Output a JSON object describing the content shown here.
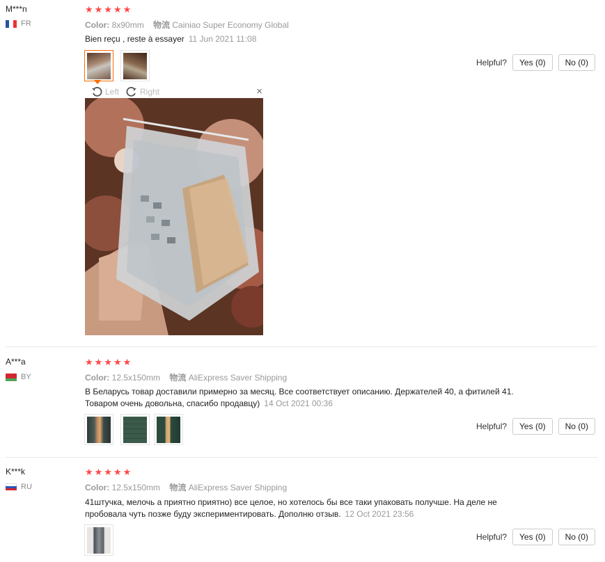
{
  "colors": {
    "star": "#ff4747",
    "active_border": "#ff6a00",
    "muted": "#999999"
  },
  "reviews": [
    {
      "user": "M***n",
      "country": "FR",
      "rating": 5,
      "color_label": "Color:",
      "color_value": "8x90mm",
      "logistics_label": "物流",
      "logistics_value": "Cainiao Super Economy Global",
      "text": "Bien reçu , reste à essayer",
      "date": "11 Jun 2021 11:08",
      "helpful": "Helpful?",
      "yes": "Yes (0)",
      "no": "No (0)"
    },
    {
      "user": "A***a",
      "country": "BY",
      "rating": 5,
      "color_label": "Color:",
      "color_value": "12.5x150mm",
      "logistics_label": "物流",
      "logistics_value": "AliExpress Saver Shipping",
      "text_line1": "В Беларусь товар доставили примерно за месяц. Все соответствует описанию. Держателей 40, а фитилей 41.",
      "text_line2": "Товаром очень довольна, спасибо продавцу)",
      "date": "14 Oct 2021 00:36",
      "helpful": "Helpful?",
      "yes": "Yes (0)",
      "no": "No (0)"
    },
    {
      "user": "K***k",
      "country": "RU",
      "rating": 5,
      "color_label": "Color:",
      "color_value": "12.5x150mm",
      "logistics_label": "物流",
      "logistics_value": "AliExpress Saver Shipping",
      "text_line1": "41штучка, мелочь а приятно приятно) все целое, но хотелось бы все таки упаковать получше. На деле не",
      "text_line2": "пробовала чуть позже буду экспериментировать. Дополню отзыв.",
      "date": "12 Oct 2021 23:56",
      "helpful": "Helpful?",
      "yes": "Yes (0)",
      "no": "No (0)"
    }
  ],
  "viewer": {
    "left": "Left",
    "right": "Right",
    "close": "×"
  }
}
